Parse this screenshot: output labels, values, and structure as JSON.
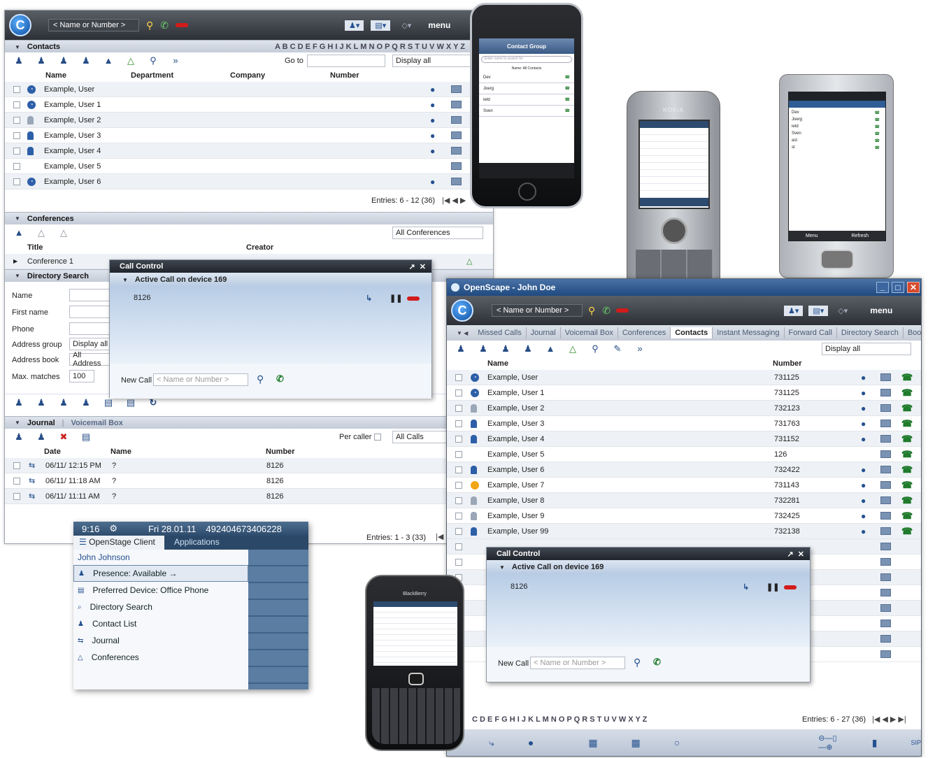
{
  "main": {
    "dial_placeholder": "< Name or Number >",
    "menu": "menu",
    "contacts_section": "Contacts",
    "alphabet": "A B C D E F G H I J K L M N O P Q R S T U V W X Y Z",
    "go_to": "Go to",
    "display_all": "Display all",
    "columns": [
      "Name",
      "Department",
      "Company",
      "Number"
    ],
    "contacts": [
      {
        "name": "Example, User",
        "presence": "busy"
      },
      {
        "name": "Example, User 1",
        "presence": "busy"
      },
      {
        "name": "Example, User 2",
        "presence": "grey"
      },
      {
        "name": "Example, User 3",
        "presence": "user"
      },
      {
        "name": "Example, User 4",
        "presence": "user"
      },
      {
        "name": "Example, User 5",
        "presence": "none"
      },
      {
        "name": "Example, User 6",
        "presence": "busy"
      }
    ],
    "entries": "Entries: 6 - 12 (36)",
    "conferences_section": "Conferences",
    "all_conferences": "All Conferences",
    "conf_columns": [
      "Title",
      "Creator"
    ],
    "conference1": "Conference 1",
    "directory_section": "Directory Search",
    "dir_fields": [
      "Name",
      "First name",
      "Phone",
      "Address group",
      "Address book",
      "Max. matches"
    ],
    "address_group_value": "Display all",
    "address_book_value": "All Address",
    "max_matches_value": "100",
    "journal_tab": "Journal",
    "voicemail_tab": "Voicemail Box",
    "per_caller": "Per caller",
    "all_calls": "All Calls",
    "journal_columns": [
      "Date",
      "Name",
      "Number"
    ],
    "journal": [
      {
        "date": "06/11/ 12:15 PM",
        "name": "?",
        "number": "8126"
      },
      {
        "date": "06/11/ 11:18 AM",
        "name": "?",
        "number": "8126"
      },
      {
        "date": "06/11/ 11:11 AM",
        "name": "?",
        "number": "8126"
      }
    ],
    "journal_entries": "Entries: 1 - 3 (33)"
  },
  "call_control": {
    "title": "Call Control",
    "active": "Active Call on device 169",
    "number": "8126",
    "new_call": "New Call",
    "placeholder": "< Name or Number >"
  },
  "win2": {
    "title": "OpenScape - John Doe",
    "dial_placeholder": "< Name or Number >",
    "menu": "menu",
    "tabs": [
      "Missed Calls",
      "Journal",
      "Voicemail Box",
      "Conferences",
      "Contacts",
      "Instant Messaging",
      "Forward Call",
      "Directory Search",
      "Bool"
    ],
    "active_tab": "Contacts",
    "display_all": "Display all",
    "columns": [
      "Name",
      "Number"
    ],
    "contacts": [
      {
        "name": "Example, User",
        "number": "731125",
        "presence": "busy"
      },
      {
        "name": "Example, User 1",
        "number": "731125",
        "presence": "busy"
      },
      {
        "name": "Example, User 2",
        "number": "732123",
        "presence": "grey"
      },
      {
        "name": "Example, User 3",
        "number": "731763",
        "presence": "user"
      },
      {
        "name": "Example, User 4",
        "number": "731152",
        "presence": "user"
      },
      {
        "name": "Example, User 5",
        "number": "126",
        "presence": "none"
      },
      {
        "name": "Example, User 6",
        "number": "732422",
        "presence": "user"
      },
      {
        "name": "Example, User 7",
        "number": "731143",
        "presence": "away"
      },
      {
        "name": "Example, User 8",
        "number": "732281",
        "presence": "grey"
      },
      {
        "name": "Example, User 9",
        "number": "732425",
        "presence": "grey"
      },
      {
        "name": "Example, User 99",
        "number": "732138",
        "presence": "user"
      }
    ],
    "alphabet": "C D E F G H I J K L M N O P Q R S T U V W X Y Z",
    "entries": "Entries: 6 - 27 (36)"
  },
  "blackberry_menu": {
    "time": "9:16",
    "date": "Fri 28.01.11",
    "number": "492404673406228",
    "tab_client": "OpenStage Client",
    "tab_apps": "Applications",
    "user": "John Johnson",
    "items": [
      "Presence: Available →",
      "Preferred Device: Office Phone",
      "Directory Search",
      "Contact List",
      "Journal",
      "Conferences"
    ]
  },
  "iphone": {
    "title": "Contact Group",
    "search": "Enter name to search for",
    "group": "Name: All Contacts",
    "contacts": [
      "Dev",
      "Joerg",
      "ietd",
      "Sven"
    ]
  },
  "nokia": {
    "brand": "NOKIA"
  },
  "winmobile": {
    "contacts": [
      "Dev",
      "Joerg",
      "ietd",
      "Sven",
      "ast",
      "st"
    ],
    "menu": "Menu",
    "refresh": "Refresh"
  },
  "blackberry": {
    "brand": "BlackBerry"
  }
}
